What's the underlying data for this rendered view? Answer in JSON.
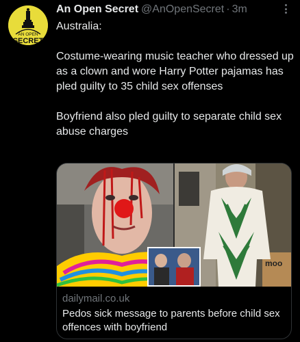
{
  "tweet": {
    "author_name": "An Open Secret",
    "author_handle": "@AnOpenSecret",
    "separator": "·",
    "time": "3m",
    "avatar_text": "AN OPEN SECRET",
    "paragraphs": [
      "Australia:",
      "Costume-wearing music teacher who dressed up as a clown and wore Harry Potter pajamas has pled guilty to 35 child sex offenses",
      "Boyfriend also pled guilty to separate child sex abuse charges"
    ]
  },
  "card": {
    "domain": "dailymail.co.uk",
    "title": "Pedos sick message to parents before child sex offences with boyfriend",
    "image_text": "moo"
  },
  "icons": {
    "more": "more-options-icon"
  },
  "colors": {
    "background": "#000000",
    "text": "#e7e9ea",
    "secondary": "#71767b",
    "border": "#2f3336",
    "avatar": "#e8dc3a"
  }
}
